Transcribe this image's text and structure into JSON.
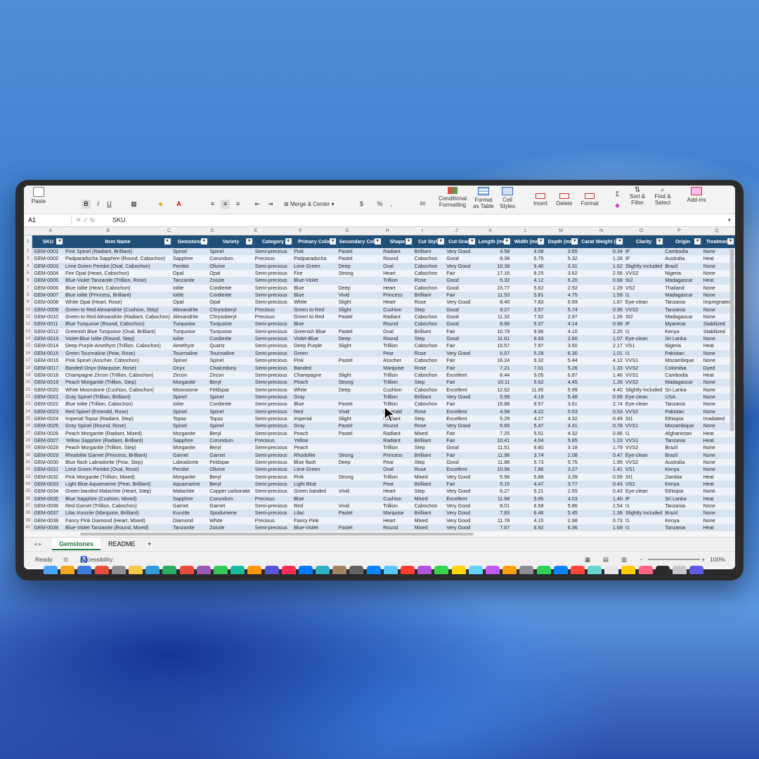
{
  "ribbon": {
    "paste_label": "Paste",
    "bold": "B",
    "italic": "I",
    "underline": "U",
    "merge_center_label": "Merge & Center",
    "currency": "$",
    "percent": "%",
    "comma": ",",
    "conditional_formatting_line1": "Conditional",
    "conditional_formatting_line2": "Formatting",
    "format_table_line1": "Format",
    "format_table_line2": "as Table",
    "cell_styles_line1": "Cell",
    "cell_styles_line2": "Styles",
    "insert_label": "Insert",
    "delete_label": "Delete",
    "format_label": "Format",
    "sort_filter_line1": "Sort &",
    "sort_filter_line2": "Filter",
    "find_select_line1": "Find &",
    "find_select_line2": "Select",
    "addins_label": "Add-ins"
  },
  "formula_bar": {
    "name_box": "A1",
    "fx": "fx",
    "value": "SKU"
  },
  "column_letters": [
    "A",
    "B",
    "C",
    "D",
    "E",
    "F",
    "G",
    "H",
    "I",
    "J",
    "K",
    "L",
    "M",
    "N",
    "O",
    "P",
    "Q"
  ],
  "table": {
    "headers": [
      "SKU",
      "Item Name",
      "Gemstone",
      "Variety",
      "Category",
      "Primary Color",
      "Secondary Color",
      "Shape",
      "Cut Style",
      "Cut Grade",
      "Length (mm)",
      "Width (mm)",
      "Depth (mm)",
      "Carat Weight (ct)",
      "Clarity",
      "Origin",
      "Treatment"
    ],
    "rows": [
      [
        "GEM-0001",
        "Pink Spinel (Radiant, Brilliant)",
        "Spinel",
        "Spinel",
        "Semi-precious",
        "Pink",
        "Pastel",
        "Radiant",
        "Brilliant",
        "Very Good",
        "4.58",
        "4.08",
        "3.65",
        "0.34",
        "IF",
        "Cambodia",
        "None"
      ],
      [
        "GEM-0002",
        "Padparadscha Sapphire (Round, Cabochon)",
        "Sapphire",
        "Corundum",
        "Precious",
        "Padparadscha",
        "Pastel",
        "Round",
        "Cabochon",
        "Good",
        "8.36",
        "5.75",
        "5.32",
        "1.28",
        "IF",
        "Australia",
        "Heat"
      ],
      [
        "GEM-0003",
        "Lime Green Peridot (Oval, Cabochon)",
        "Peridot",
        "Olivine",
        "Semi-precious",
        "Lime Green",
        "Deep",
        "Oval",
        "Cabochon",
        "Very Good",
        "10.39",
        "9.40",
        "3.31",
        "1.62",
        "Slightly Included",
        "Brazil",
        "None"
      ],
      [
        "GEM-0004",
        "Fire Opal (Heart, Cabochon)",
        "Opal",
        "Opal",
        "Semi-precious",
        "Fire",
        "Strong",
        "Heart",
        "Cabochon",
        "Fair",
        "17.16",
        "8.25",
        "3.62",
        "2.56",
        "VVS2",
        "Nigeria",
        "None"
      ],
      [
        "GEM-0005",
        "Blue-Violet Tanzanite (Trillion, Rose)",
        "Tanzanite",
        "Zoisite",
        "Semi-precious",
        "Blue-Violet",
        "",
        "Trillion",
        "Rose",
        "Good",
        "5.32",
        "4.12",
        "6.20",
        "0.68",
        "SI2",
        "Madagascar",
        "Heat"
      ],
      [
        "GEM-0006",
        "Blue Iolite (Heart, Cabochon)",
        "Iolite",
        "Cordierite",
        "Semi-precious",
        "Blue",
        "Deep",
        "Heart",
        "Cabochon",
        "Good",
        "15.77",
        "5.62",
        "2.92",
        "1.29",
        "VS2",
        "Thailand",
        "None"
      ],
      [
        "GEM-0007",
        "Blue Iolite (Princess, Brilliant)",
        "Iolite",
        "Cordierite",
        "Semi-precious",
        "Blue",
        "Vivid",
        "Princess",
        "Brilliant",
        "Fair",
        "11.53",
        "5.81",
        "4.75",
        "1.59",
        "I1",
        "Madagascar",
        "None"
      ],
      [
        "GEM-0008",
        "White Opal (Heart, Rose)",
        "Opal",
        "Opal",
        "Semi-precious",
        "White",
        "Slight",
        "Heart",
        "Rose",
        "Very Good",
        "8.40",
        "7.83",
        "5.69",
        "1.87",
        "Eye-clean",
        "Tanzania",
        "Impregnated"
      ],
      [
        "GEM-0009",
        "Green to Red Alexandrite (Cushion, Step)",
        "Alexandrite",
        "Chrysoberyl",
        "Precious",
        "Green to Red",
        "Slight",
        "Cushion",
        "Step",
        "Good",
        "9.27",
        "3.57",
        "5.74",
        "0.95",
        "VVS2",
        "Tanzania",
        "None"
      ],
      [
        "GEM-0010",
        "Green to Red Alexandrite (Radiant, Cabochon)",
        "Alexandrite",
        "Chrysoberyl",
        "Precious",
        "Green to Red",
        "Pastel",
        "Radiant",
        "Cabochon",
        "Good",
        "11.32",
        "7.52",
        "2.97",
        "1.26",
        "SI2",
        "Madagascar",
        "None"
      ],
      [
        "GEM-0011",
        "Blue Turquoise (Round, Cabochon)",
        "Turquoise",
        "Turquoise",
        "Semi-precious",
        "Blue",
        "",
        "Round",
        "Cabochon",
        "Good",
        "8.66",
        "5.37",
        "4.14",
        "0.96",
        "IF",
        "Myanmar",
        "Stabilized"
      ],
      [
        "GEM-0012",
        "Greenish Blue Turquoise (Oval, Brilliant)",
        "Turquoise",
        "Turquoise",
        "Semi-precious",
        "Greenish Blue",
        "Pastel",
        "Oval",
        "Brilliant",
        "Fair",
        "10.79",
        "9.96",
        "4.10",
        "2.20",
        "I1",
        "Kenya",
        "Stabilized"
      ],
      [
        "GEM-0013",
        "Violet-Blue Iolite (Round, Step)",
        "Iolite",
        "Cordierite",
        "Semi-precious",
        "Violet-Blue",
        "Deep",
        "Round",
        "Step",
        "Good",
        "11.61",
        "6.93",
        "2.66",
        "1.07",
        "Eye-clean",
        "Sri Lanka",
        "None"
      ],
      [
        "GEM-0014",
        "Deep Purple Amethyst (Trillion, Cabochon)",
        "Amethyst",
        "Quartz",
        "Semi-precious",
        "Deep Purple",
        "Slight",
        "Trillion",
        "Cabochon",
        "Fair",
        "15.57",
        "7.97",
        "3.50",
        "2.17",
        "VS1",
        "Nigeria",
        "Heat"
      ],
      [
        "GEM-0015",
        "Green Tourmaline (Pear, Rose)",
        "Tourmaline",
        "Tourmaline",
        "Semi-precious",
        "Green",
        "",
        "Pear",
        "Rose",
        "Very Good",
        "6.07",
        "5.28",
        "6.30",
        "1.01",
        "I1",
        "Pakistan",
        "None"
      ],
      [
        "GEM-0016",
        "Pink Spinel (Asscher, Cabochon)",
        "Spinel",
        "Spinel",
        "Semi-precious",
        "Pink",
        "Pastel",
        "Asscher",
        "Cabochon",
        "Fair",
        "16.24",
        "9.32",
        "5.44",
        "4.12",
        "VVS1",
        "Mozambique",
        "None"
      ],
      [
        "GEM-0017",
        "Banded Onyx (Marquise, Rose)",
        "Onyx",
        "Chalcedony",
        "Semi-precious",
        "Banded",
        "",
        "Marquise",
        "Rose",
        "Fair",
        "7.21",
        "7.01",
        "5.26",
        "1.33",
        "VVS2",
        "Colombia",
        "Dyed"
      ],
      [
        "GEM-0018",
        "Champagne Zircon (Trillion, Cabochon)",
        "Zircon",
        "Zircon",
        "Semi-precious",
        "Champagne",
        "Slight",
        "Trillion",
        "Cabochon",
        "Excellent",
        "8.44",
        "5.05",
        "6.87",
        "1.46",
        "VVS1",
        "Cambodia",
        "Heat"
      ],
      [
        "GEM-0019",
        "Peach Morganite (Trillion, Step)",
        "Morganite",
        "Beryl",
        "Semi-precious",
        "Peach",
        "Strong",
        "Trillion",
        "Step",
        "Fair",
        "10.11",
        "5.62",
        "4.45",
        "1.26",
        "VVS2",
        "Madagascar",
        "None"
      ],
      [
        "GEM-0020",
        "White Moonstone (Cushion, Cabochon)",
        "Moonstone",
        "Feldspar",
        "Semi-precious",
        "White",
        "Deep",
        "Cushion",
        "Cabochon",
        "Excellent",
        "12.62",
        "11.65",
        "5.99",
        "4.40",
        "Slightly Included",
        "Sri Lanka",
        "None"
      ],
      [
        "GEM-0021",
        "Gray Spinel (Trillion, Brilliant)",
        "Spinel",
        "Spinel",
        "Semi-precious",
        "Gray",
        "",
        "Trillion",
        "Brilliant",
        "Very Good",
        "5.99",
        "4.19",
        "5.48",
        "0.69",
        "Eye-clean",
        "USA",
        "None"
      ],
      [
        "GEM-0022",
        "Blue Iolite (Trillion, Cabochon)",
        "Iolite",
        "Cordierite",
        "Semi-precious",
        "Blue",
        "Pastel",
        "Trillion",
        "Cabochon",
        "Fair",
        "15.88",
        "9.57",
        "3.61",
        "2.74",
        "Eye-clean",
        "Tanzania",
        "None"
      ],
      [
        "GEM-0023",
        "Red Spinel (Emerald, Rose)",
        "Spinel",
        "Spinel",
        "Semi-precious",
        "Red",
        "Vivid",
        "Emerald",
        "Rose",
        "Excellent",
        "4.58",
        "4.22",
        "5.53",
        "0.53",
        "VVS2",
        "Pakistan",
        "None"
      ],
      [
        "GEM-0024",
        "Imperial Topaz (Radiant, Step)",
        "Topaz",
        "Topaz",
        "Semi-precious",
        "Imperial",
        "Slight",
        "Radiant",
        "Step",
        "Excellent",
        "5.29",
        "4.27",
        "4.32",
        "0.49",
        "SI1",
        "Ethiopia",
        "Irradiated"
      ],
      [
        "GEM-0025",
        "Gray Spinel (Round, Rose)",
        "Spinel",
        "Spinel",
        "Semi-precious",
        "Gray",
        "Pastel",
        "Round",
        "Rose",
        "Very Good",
        "6.65",
        "5.47",
        "4.31",
        "0.78",
        "VVS1",
        "Mozambique",
        "None"
      ],
      [
        "GEM-0026",
        "Peach Morganite (Radiant, Mixed)",
        "Morganite",
        "Beryl",
        "Semi-precious",
        "Peach",
        "Pastel",
        "Radiant",
        "Mixed",
        "Fair",
        "7.25",
        "5.51",
        "4.32",
        "0.86",
        "I1",
        "Afghanistan",
        "Heat"
      ],
      [
        "GEM-0027",
        "Yellow Sapphire (Radiant, Brilliant)",
        "Sapphire",
        "Corundum",
        "Precious",
        "Yellow",
        "",
        "Radiant",
        "Brilliant",
        "Fair",
        "10.41",
        "4.04",
        "5.85",
        "1.23",
        "VVS1",
        "Tanzania",
        "Heat"
      ],
      [
        "GEM-0028",
        "Peach Morganite (Trillion, Step)",
        "Morganite",
        "Beryl",
        "Semi-precious",
        "Peach",
        "",
        "Trillion",
        "Step",
        "Good",
        "11.51",
        "9.80",
        "3.18",
        "1.79",
        "VVS2",
        "Brazil",
        "None"
      ],
      [
        "GEM-0029",
        "Rhodolite Garnet (Princess, Brilliant)",
        "Garnet",
        "Garnet",
        "Semi-precious",
        "Rhodolite",
        "Strong",
        "Princess",
        "Brilliant",
        "Fair",
        "11.96",
        "3.74",
        "2.08",
        "0.47",
        "Eye-clean",
        "Brazil",
        "None"
      ],
      [
        "GEM-0030",
        "Blue flash Labradorite (Pear, Step)",
        "Labradorite",
        "Feldspar",
        "Semi-precious",
        "Blue flash",
        "Deep",
        "Pear",
        "Step",
        "Good",
        "11.86",
        "5.73",
        "5.75",
        "1.95",
        "VVS2",
        "Australia",
        "None"
      ],
      [
        "GEM-0031",
        "Lime Green Peridot (Oval, Rose)",
        "Peridot",
        "Olivine",
        "Semi-precious",
        "Lime Green",
        "",
        "Oval",
        "Rose",
        "Excellent",
        "10.96",
        "7.86",
        "3.27",
        "1.41",
        "VS1",
        "Kenya",
        "None"
      ],
      [
        "GEM-0032",
        "Pink Morganite (Trillion, Mixed)",
        "Morganite",
        "Beryl",
        "Semi-precious",
        "Pink",
        "Strong",
        "Trillion",
        "Mixed",
        "Very Good",
        "5.96",
        "5.88",
        "3.39",
        "0.59",
        "SI1",
        "Zambia",
        "Heat"
      ],
      [
        "GEM-0033",
        "Light Blue Aquamarine (Pear, Brilliant)",
        "Aquamarine",
        "Beryl",
        "Semi-precious",
        "Light Blue",
        "",
        "Pear",
        "Brilliant",
        "Fair",
        "5.15",
        "4.47",
        "3.77",
        "0.43",
        "VS2",
        "Kenya",
        "Heat"
      ],
      [
        "GEM-0034",
        "Green banded Malachite (Heart, Step)",
        "Malachite",
        "Copper carbonate",
        "Semi-precious",
        "Green banded",
        "Vivid",
        "Heart",
        "Step",
        "Very Good",
        "6.27",
        "5.21",
        "2.65",
        "0.43",
        "Eye-clean",
        "Ethiopia",
        "None"
      ],
      [
        "GEM-0035",
        "Blue Sapphire (Cushion, Mixed)",
        "Sapphire",
        "Corundum",
        "Precious",
        "Blue",
        "",
        "Cushion",
        "Mixed",
        "Excellent",
        "11.68",
        "5.95",
        "4.03",
        "1.40",
        "IF",
        "Sri Lanka",
        "Heat"
      ],
      [
        "GEM-0036",
        "Red Garnet (Trillion, Cabochon)",
        "Garnet",
        "Garnet",
        "Semi-precious",
        "Red",
        "Vivid",
        "Trillion",
        "Cabochon",
        "Very Good",
        "8.01",
        "6.58",
        "5.86",
        "1.54",
        "I1",
        "Tanzania",
        "None"
      ],
      [
        "GEM-0037",
        "Lilac Kunzite (Marquise, Brilliant)",
        "Kunzite",
        "Spodumene",
        "Semi-precious",
        "Lilac",
        "Pastel",
        "Marquise",
        "Brilliant",
        "Very Good",
        "7.83",
        "6.46",
        "5.45",
        "1.38",
        "Slightly Included",
        "Brazil",
        "None"
      ],
      [
        "GEM-0038",
        "Fancy Pink Diamond (Heart, Mixed)",
        "Diamond",
        "White",
        "Precious",
        "Fancy Pink",
        "",
        "Heart",
        "Mixed",
        "Very Good",
        "11.78",
        "4.15",
        "2.98",
        "0.73",
        "I1",
        "Kenya",
        "None"
      ],
      [
        "GEM-0039",
        "Blue-Violet Tanzanite (Round, Mixed)",
        "Tanzanite",
        "Zoisite",
        "Semi-precious",
        "Blue-Violet",
        "Pastel",
        "Round",
        "Mixed",
        "Very Good",
        "7.67",
        "6.92",
        "6.36",
        "1.69",
        "I1",
        "Tanzania",
        "Heat"
      ]
    ]
  },
  "sheet_tabs": {
    "active": "Gemstones",
    "other": "README",
    "add": "+"
  },
  "status": {
    "ready": "Ready",
    "accessibility": "Accessibility: Investigate",
    "zoom": "100%"
  },
  "colors": {
    "header_bg": "#1f4e79",
    "row_band_1": "#d9e4f1",
    "row_band_2": "#eef3f9",
    "accent_green": "#1a7a3e"
  }
}
